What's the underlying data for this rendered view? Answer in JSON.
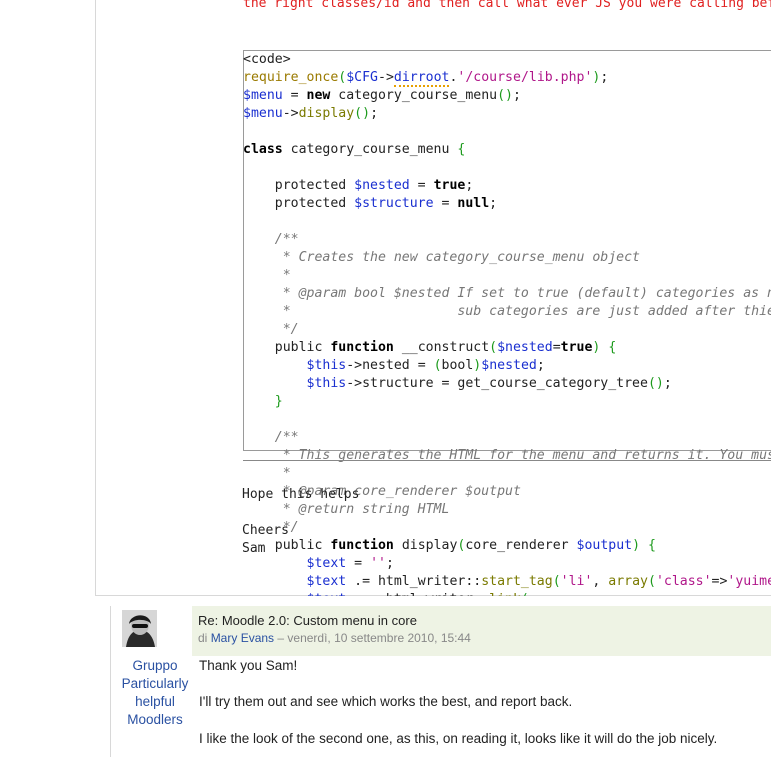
{
  "post1": {
    "red_text": "the right classes/id and then call what ever JS you were calling bef",
    "code_lines": [
      "<code>",
      "require_once($CFG->dirroot.'/course/lib.php');",
      "$menu = new category_course_menu();",
      "$menu->display();",
      "",
      "class category_course_menu {",
      "",
      "    protected $nested = true;",
      "    protected $structure = null;",
      "",
      "    /**",
      "     * Creates the new category_course_menu object",
      "     *",
      "     * @param bool $nested If set to true (default) categories as ne",
      "     *                     sub categories are just added after thie",
      "     */",
      "    public function __construct($nested=true) {",
      "        $this->nested = (bool)$nested;",
      "        $this->structure = get_course_category_tree();",
      "    }",
      "",
      "    /**",
      "     * This generates the HTML for the menu and returns it. You must",
      "     *",
      "     * @param core_renderer $output",
      "     * @return string HTML",
      "     */",
      "    public function display(core_renderer $output) {",
      "        $text = '';",
      "        $text .= html_writer::start_tag('li', array('class'=>'yuimer",
      "        $text .= html_writer::link("
    ],
    "hope_text": "Hope this helps",
    "cheers_text": "Cheers",
    "sam_text": "Sam"
  },
  "post2": {
    "title": "Re: Moodle 2.0: Custom menu in core",
    "by_prefix": "di",
    "author": "Mary Evans",
    "date": "– venerdì, 10 settembre 2010, 15:44",
    "group_lines": [
      "Gruppo",
      "Particularly",
      "helpful",
      "Moodlers"
    ],
    "paragraphs": [
      "Thank you Sam!",
      "I'll try them out and see which works the best, and report back.",
      "I like the look of the second one, as this, on reading it, looks like it will do the job nicely."
    ]
  }
}
